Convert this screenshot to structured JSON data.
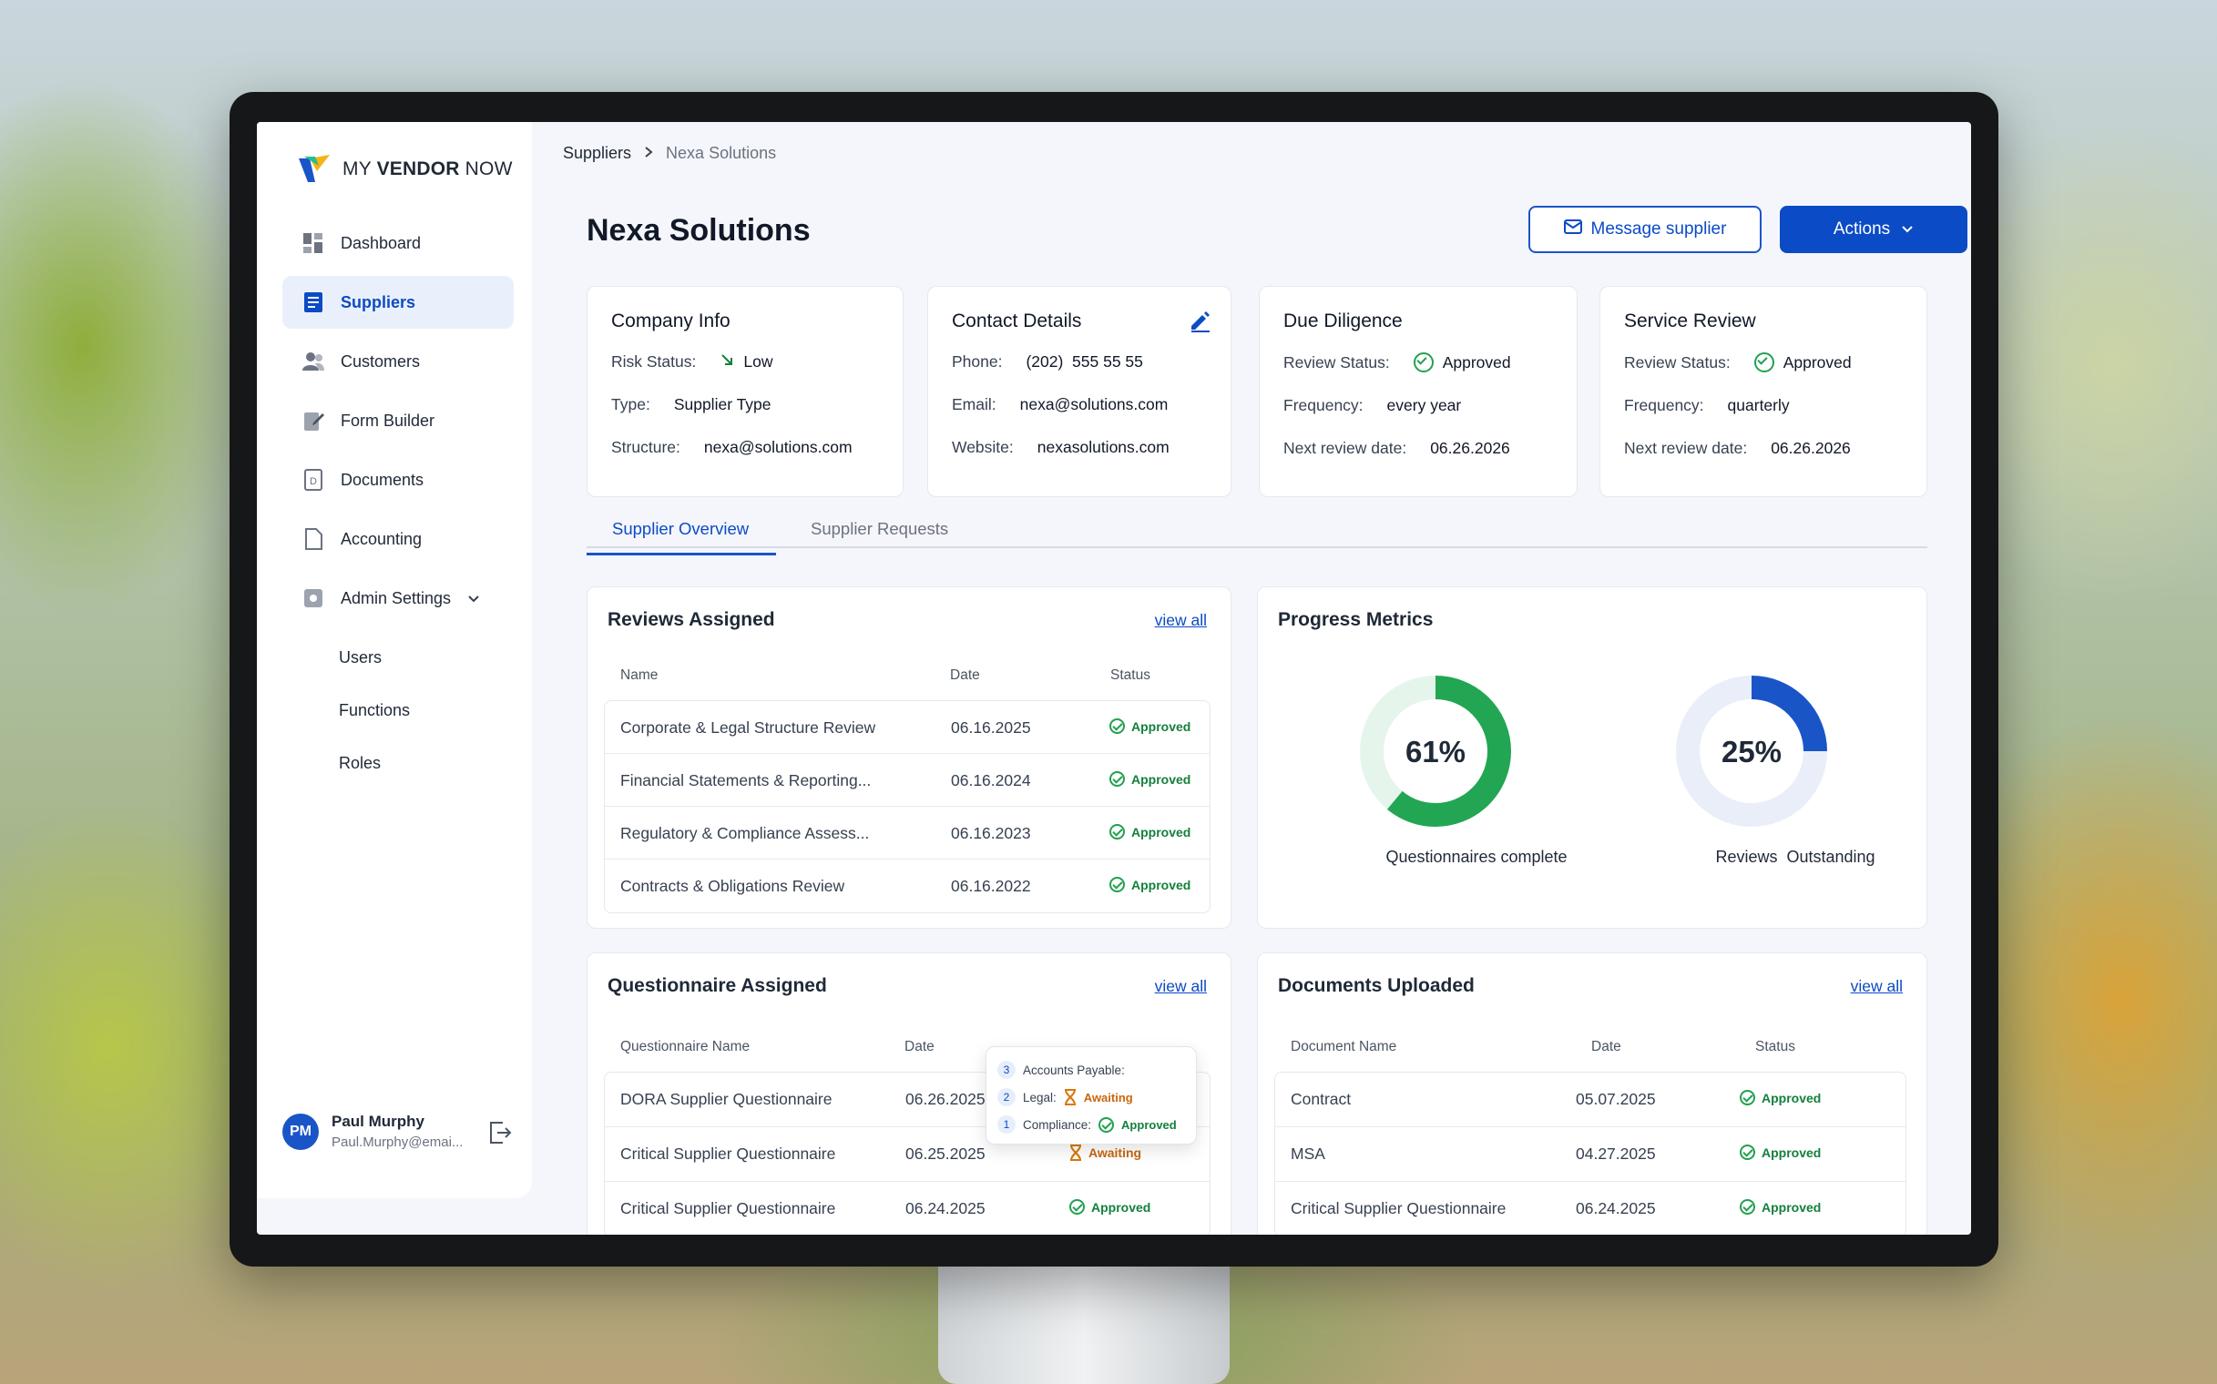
{
  "app": {
    "logo_prefix": "MY",
    "logo_bold": "VENDOR",
    "logo_suffix": "NOW"
  },
  "colors": {
    "brand": "#0b4bc5",
    "approved": "#13803c",
    "awaiting": "#c7670d",
    "donut1": "#22a653",
    "donut2": "#1a55c8"
  },
  "sidebar": {
    "items": [
      {
        "label": "Dashboard",
        "icon": "grid-icon"
      },
      {
        "label": "Suppliers",
        "icon": "list-icon",
        "active": true
      },
      {
        "label": "Customers",
        "icon": "users-icon"
      },
      {
        "label": "Form Builder",
        "icon": "form-icon"
      },
      {
        "label": "Documents",
        "icon": "document-icon"
      },
      {
        "label": "Accounting",
        "icon": "file-icon"
      },
      {
        "label": "Admin Settings",
        "icon": "settings-icon"
      }
    ],
    "sub_items": [
      "Users",
      "Functions",
      "Roles"
    ]
  },
  "user": {
    "initials": "PM",
    "name": "Paul Murphy",
    "email": "Paul.Murphy@emai..."
  },
  "breadcrumb": {
    "root": "Suppliers",
    "current": "Nexa Solutions"
  },
  "page_title": "Nexa Solutions",
  "buttons": {
    "message": "Message supplier",
    "actions": "Actions"
  },
  "company_info": {
    "title": "Company Info",
    "risk_label": "Risk Status:",
    "risk_value": "Low",
    "type_label": "Type:",
    "type_value": "Supplier Type",
    "structure_label": "Structure:",
    "structure_value": "nexa@solutions.com"
  },
  "contact": {
    "title": "Contact Details",
    "phone_label": "Phone:",
    "phone_value": "(202)  555 55 55",
    "email_label": "Email:",
    "email_value": "nexa@solutions.com",
    "website_label": "Website:",
    "website_value": "nexasolutions.com"
  },
  "due_diligence": {
    "title": "Due Diligence",
    "status_label": "Review Status:",
    "status_value": "Approved",
    "freq_label": "Frequency:",
    "freq_value": "every year",
    "next_label": "Next review date:",
    "next_value": "06.26.2026"
  },
  "service_review": {
    "title": "Service Review",
    "status_label": "Review Status:",
    "status_value": "Approved",
    "freq_label": "Frequency:",
    "freq_value": "quarterly",
    "next_label": "Next review date:",
    "next_value": "06.26.2026"
  },
  "tabs": [
    "Supplier Overview",
    "Supplier Requests"
  ],
  "reviews": {
    "title": "Reviews Assigned",
    "view_all": "view all",
    "headers": [
      "Name",
      "Date",
      "Status"
    ],
    "rows": [
      {
        "name": "Corporate & Legal Structure Review",
        "date": "06.16.2025",
        "status": "Approved"
      },
      {
        "name": "Financial Statements & Reporting...",
        "date": "06.16.2024",
        "status": "Approved"
      },
      {
        "name": "Regulatory & Compliance Assess...",
        "date": "06.16.2023",
        "status": "Approved"
      },
      {
        "name": "Contracts & Obligations Review",
        "date": "06.16.2022",
        "status": "Approved"
      }
    ]
  },
  "metrics": {
    "title": "Progress Metrics",
    "donuts": [
      {
        "value_pct": 61,
        "label": "61%",
        "caption": "Questionnaires complete"
      },
      {
        "value_pct": 25,
        "label": "25%",
        "caption": "Reviews  Outstanding"
      }
    ]
  },
  "questionnaires": {
    "title": "Questionnaire Assigned",
    "view_all": "view all",
    "headers": [
      "Questionnaire Name",
      "Date"
    ],
    "rows": [
      {
        "name": "DORA Supplier Questionnaire",
        "date": "06.26.2025",
        "status": ""
      },
      {
        "name": "Critical Supplier Questionnaire",
        "date": "06.25.2025",
        "status": "Awaiting"
      },
      {
        "name": "Critical Supplier Questionnaire",
        "date": "06.24.2025",
        "status": "Approved"
      }
    ]
  },
  "tooltip": {
    "rows": [
      {
        "num": "3",
        "label": "Accounts Payable:",
        "status": ""
      },
      {
        "num": "2",
        "label": "Legal:",
        "status": "Awaiting"
      },
      {
        "num": "1",
        "label": "Compliance:",
        "status": "Approved"
      }
    ]
  },
  "documents": {
    "title": "Documents Uploaded",
    "view_all": "view all",
    "headers": [
      "Document Name",
      "Date",
      "Status"
    ],
    "rows": [
      {
        "name": "Contract",
        "date": "05.07.2025",
        "status": "Approved"
      },
      {
        "name": "MSA",
        "date": "04.27.2025",
        "status": "Approved"
      },
      {
        "name": "Critical Supplier Questionnaire",
        "date": "06.24.2025",
        "status": "Approved"
      }
    ]
  }
}
